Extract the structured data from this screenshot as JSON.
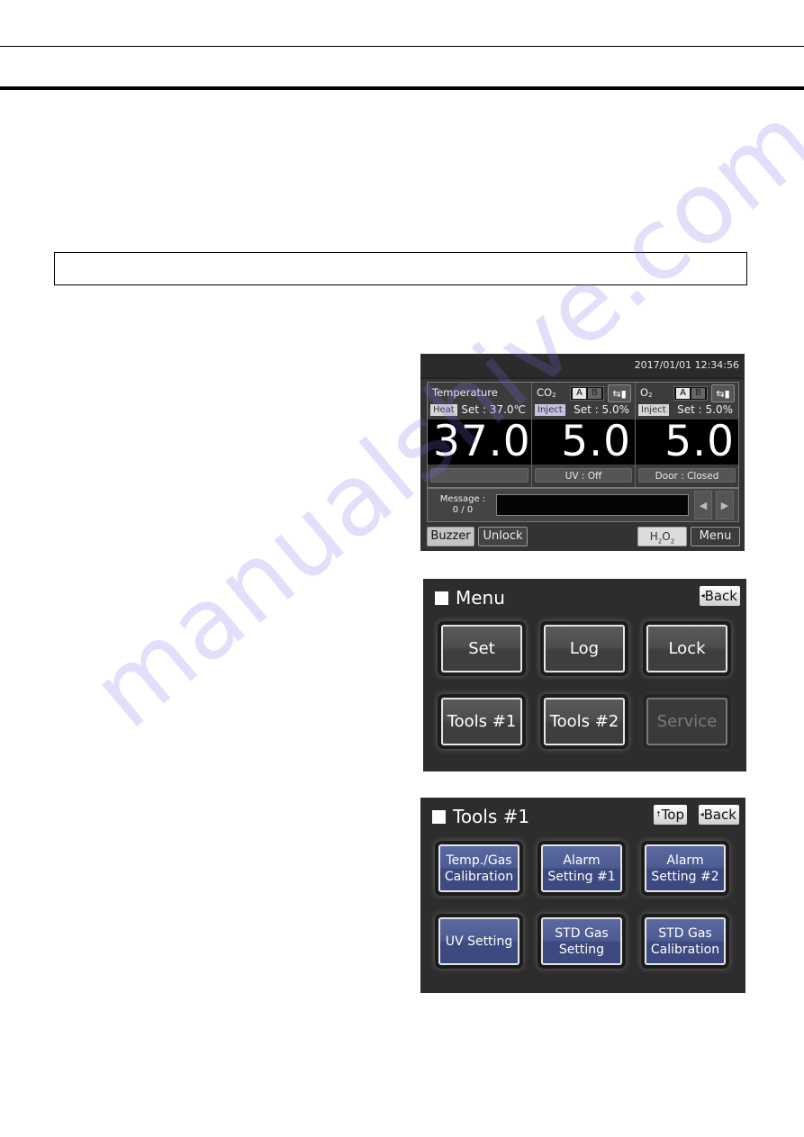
{
  "watermark": "manualshive.com",
  "home_screen": {
    "datetime": "2017/01/01  12:34:56",
    "columns": [
      {
        "id": "temperature",
        "title": "Temperature",
        "title_sub": "",
        "badge": "Heat",
        "set_label": "Set : 37.0℃",
        "value": "37.0",
        "status": ""
      },
      {
        "id": "co2",
        "title": "CO",
        "title_sub": "2",
        "badge": "Inject",
        "set_label": "Set :   5.0%",
        "value": "5.0",
        "status": "UV : Off",
        "ab": [
          "A",
          "B"
        ],
        "ab_selected": "A",
        "gas_icon": "gas-cylinder-switch-icon"
      },
      {
        "id": "o2",
        "title": "O",
        "title_sub": "2",
        "badge": "Inject",
        "set_label": "Set :   5.0%",
        "value": "5.0",
        "status": "Door : Closed",
        "ab": [
          "A",
          "B"
        ],
        "ab_selected": "A",
        "gas_icon": "gas-cylinder-switch-icon"
      }
    ],
    "message": {
      "label": "Message :",
      "count": "0 / 0",
      "text": ""
    },
    "arrows": {
      "prev": "◀",
      "next": "▶"
    },
    "buttons": {
      "buzzer": "Buzzer",
      "unlock": "Unlock",
      "h2o2_main": "H",
      "h2o2_sub1": "2",
      "h2o2_mid": "O",
      "h2o2_sub2": "2",
      "menu": "Menu"
    }
  },
  "menu_screen": {
    "title": "Menu",
    "back": "Back",
    "tiles": [
      {
        "label": "Set",
        "enabled": true
      },
      {
        "label": "Log",
        "enabled": true
      },
      {
        "label": "Lock",
        "enabled": true
      },
      {
        "label": "Tools #1",
        "enabled": true
      },
      {
        "label": "Tools #2",
        "enabled": true
      },
      {
        "label": "Service",
        "enabled": false
      }
    ]
  },
  "tools_screen": {
    "title": "Tools #1",
    "top": "Top",
    "back": "Back",
    "tiles": [
      {
        "label": "Temp./Gas\nCalibration"
      },
      {
        "label": "Alarm\nSetting #1"
      },
      {
        "label": "Alarm\nSetting #2"
      },
      {
        "label": "UV Setting"
      },
      {
        "label": "STD Gas\nSetting"
      },
      {
        "label": "STD Gas\nCalibration"
      }
    ]
  },
  "icons": {
    "triangle_left": "◂",
    "arrow_up": "↑",
    "gas_switch": "⇆▮"
  }
}
